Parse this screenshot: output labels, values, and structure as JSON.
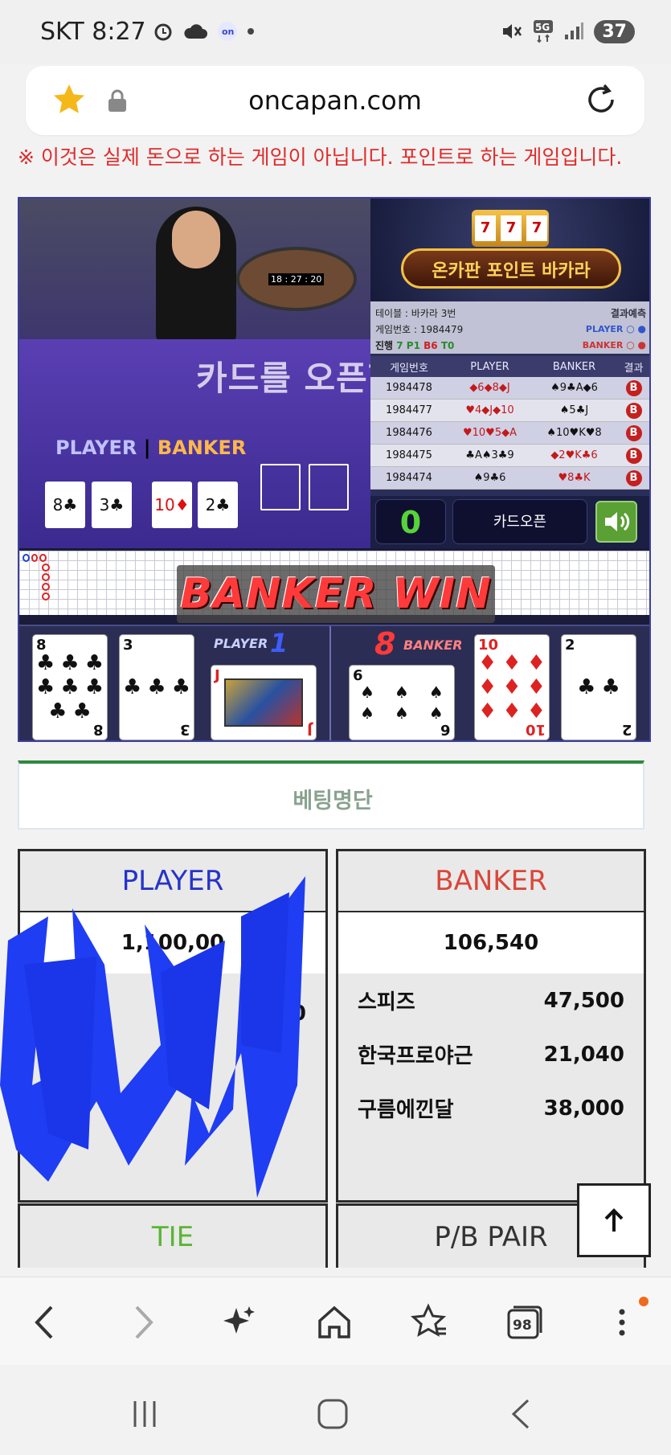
{
  "status_bar": {
    "carrier_time": "SKT 8:27",
    "network": "5G",
    "battery": "37",
    "icons_left": [
      "alarm-icon",
      "cloud-icon",
      "app-icon",
      "dot-icon"
    ],
    "icons_right": [
      "mute-icon",
      "5g-icon",
      "signal-icon",
      "battery-icon"
    ]
  },
  "url_bar": {
    "url": "oncapan.com",
    "star_color": "#f5b81b"
  },
  "notice": "※ 이것은 실제 돈으로 하는 게임이 아닙니다. 포인트로 하는 게임입니다.",
  "video": {
    "cam_clock": "18 : 27 : 20",
    "overlay_text": "카드를 오픈합니다.",
    "player_label": "PLAYER",
    "banker_label": "BANKER",
    "player_mini_cards": [
      "8♣",
      "3♣"
    ],
    "banker_mini_cards": [
      "10♦",
      "2♣"
    ],
    "logo_slot": [
      "7",
      "7",
      "7"
    ],
    "logo_text": "온카판 포인트 바카라",
    "table_info": "테이블 : 바카라 3번",
    "result_predict": "결과예측",
    "game_number": "게임번호 : 1984479",
    "legend_player": "PLAYER",
    "legend_banker": "BANKER",
    "progress_label": "진행",
    "progress_p": "7 P1",
    "progress_b": "B6",
    "progress_t": "T0",
    "history_headers": [
      "게임번호",
      "PLAYER",
      "BANKER",
      "결과"
    ],
    "history": [
      {
        "game": "1984478",
        "player": "◆6◆8◆J",
        "banker": "♠9♣A◆6",
        "result": "B"
      },
      {
        "game": "1984477",
        "player": "♥4◆J◆10",
        "banker": "♠5♣J",
        "result": "B"
      },
      {
        "game": "1984476",
        "player": "♥10♥5◆A",
        "banker": "♠10♥K♥8",
        "result": "B"
      },
      {
        "game": "1984475",
        "player": "♣A♠3♣9",
        "banker": "◆2♥K♣6",
        "result": "B"
      },
      {
        "game": "1984474",
        "player": "♠9♣6",
        "banker": "♥8♣K",
        "result": "B"
      }
    ],
    "count": "0",
    "open_button": "카드오픈",
    "banner": "BANKER WIN",
    "player_score_label": "PLAYER",
    "player_score": "1",
    "banker_score": "8",
    "banker_score_label": "BANKER",
    "cards": [
      {
        "rank": "8",
        "suit": "♣",
        "color": "black",
        "pips": 8
      },
      {
        "rank": "3",
        "suit": "♣",
        "color": "black",
        "pips": 3
      },
      {
        "rank": "J",
        "suit": "♥",
        "color": "red",
        "face": true
      },
      {
        "rank": "6",
        "suit": "♠",
        "color": "black",
        "pips": 6
      },
      {
        "rank": "10",
        "suit": "♦",
        "color": "red",
        "pips": 10
      },
      {
        "rank": "2",
        "suit": "♣",
        "color": "black",
        "pips": 2
      }
    ]
  },
  "betting": {
    "title": "베팅명단",
    "player_header": "PLAYER",
    "player_color": "#2634c8",
    "player_total": "1,100,00",
    "player_partial": "0",
    "banker_header": "BANKER",
    "banker_color": "#d9473a",
    "banker_total": "106,540",
    "banker_rows": [
      {
        "name": "스피즈",
        "amount": "47,500"
      },
      {
        "name": "한국프로야근",
        "amount": "21,040"
      },
      {
        "name": "구름에낀달",
        "amount": "38,000"
      }
    ],
    "tie_header": "TIE",
    "tie_color": "#5ab534",
    "pair_header": "P/B PAIR"
  },
  "toolbar": {
    "tabs_count": "98",
    "items": [
      "back-icon",
      "forward-icon",
      "sparkle-icon",
      "home-icon",
      "bookmark-icon",
      "tabs-icon",
      "more-icon"
    ]
  },
  "navbar": {
    "items": [
      "recents-icon",
      "home-button-icon",
      "nav-back-icon"
    ]
  }
}
